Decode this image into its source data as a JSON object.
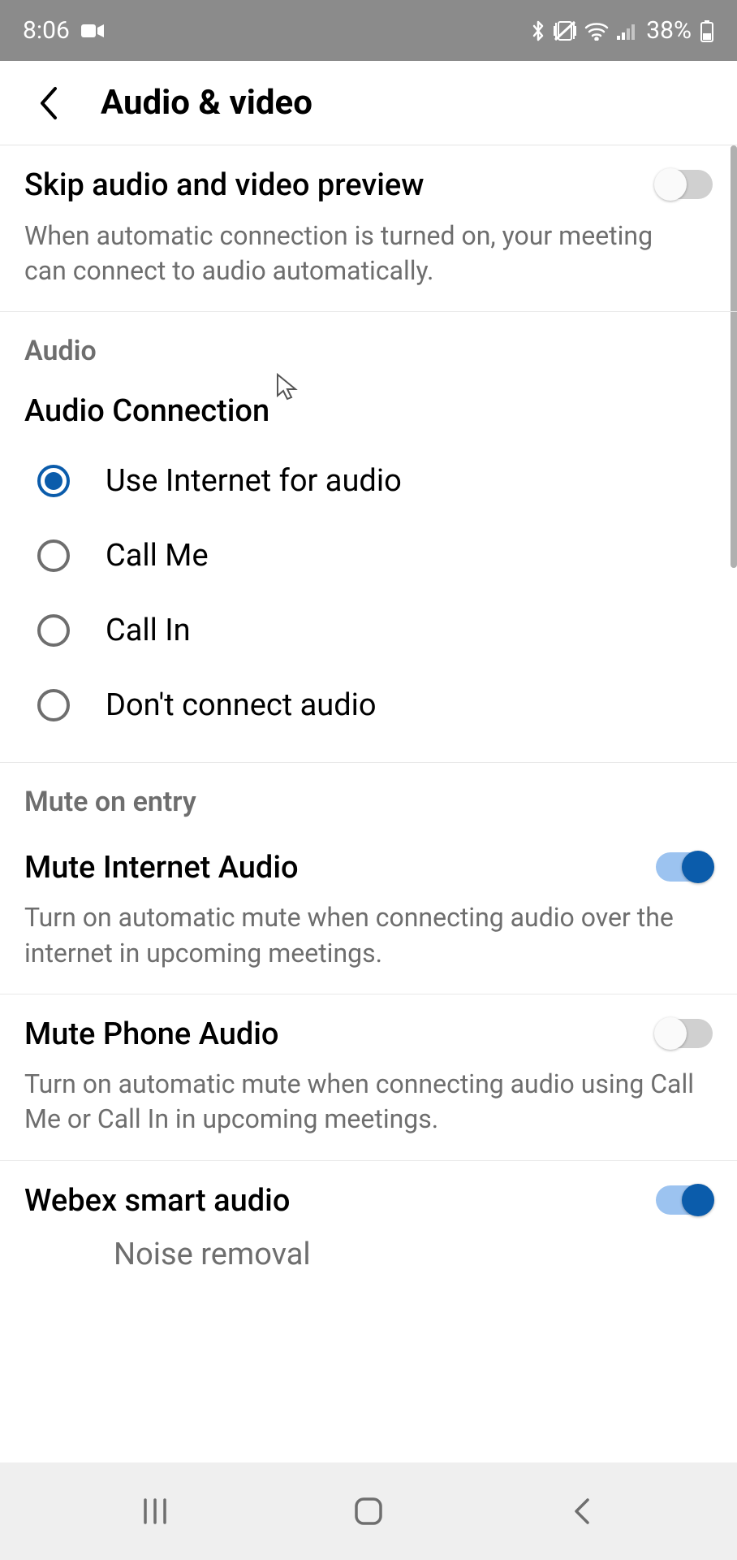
{
  "status": {
    "time": "8:06",
    "battery": "38%"
  },
  "header": {
    "title": "Audio & video"
  },
  "skip_preview": {
    "title": "Skip audio and video preview",
    "desc": "When automatic connection is turned on, your meeting can connect to audio automatically.",
    "on": false
  },
  "sections": {
    "audio_label": "Audio",
    "audio_conn_label": "Audio Connection",
    "mute_label": "Mute on entry"
  },
  "audio_options": [
    {
      "label": "Use Internet for audio",
      "selected": true
    },
    {
      "label": "Call Me",
      "selected": false
    },
    {
      "label": "Call In",
      "selected": false
    },
    {
      "label": "Don't connect audio",
      "selected": false
    }
  ],
  "mute_internet": {
    "title": "Mute Internet Audio",
    "desc": "Turn on automatic mute when connecting audio over the internet in upcoming meetings.",
    "on": true
  },
  "mute_phone": {
    "title": "Mute Phone Audio",
    "desc": "Turn on automatic mute when connecting audio using Call Me or Call In in upcoming meetings.",
    "on": false
  },
  "smart_audio": {
    "title": "Webex smart audio",
    "on": true,
    "option_label": "Noise removal"
  }
}
